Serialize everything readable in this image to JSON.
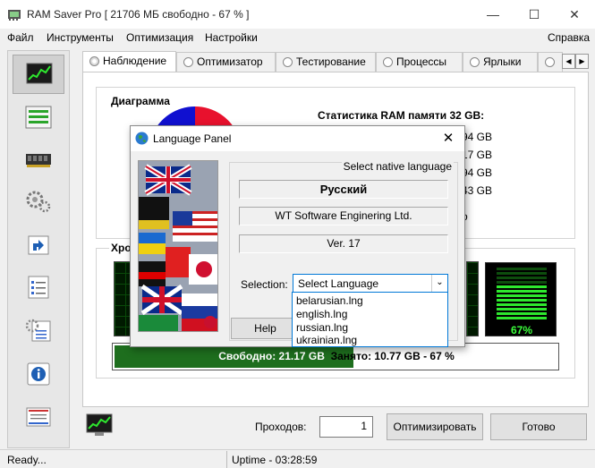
{
  "window": {
    "title": "RAM Saver Pro [ 21706 МБ свободно - 67 % ]",
    "minimize": "—",
    "maximize": "☐",
    "close": "✕"
  },
  "menu": {
    "file": "Файл",
    "tools": "Инструменты",
    "optimization": "Оптимизация",
    "settings": "Настройки",
    "help": "Справка"
  },
  "sidebar": {
    "icons": [
      "monitor-chart-icon",
      "memory-bars-icon",
      "ram-chip-icon",
      "gears-icon",
      "shortcut-arrow-icon",
      "checklist-icon",
      "settings-list-icon",
      "info-icon",
      "report-icon"
    ]
  },
  "tabs": [
    "Наблюдение",
    "Оптимизатор",
    "Тестирование",
    "Процессы",
    "Ярлыки"
  ],
  "tab_scroll": {
    "left": "◀",
    "right": "▶"
  },
  "monitor": {
    "diagram_title": "Диаграмма",
    "stats_title": "Статистика RAM памяти 32 GB:",
    "stat_values": [
      "94 GB",
      "17 GB",
      "94 GB",
      "43 GB"
    ],
    "partial_text": "o",
    "chrono_partial": "Хро",
    "meter_percent": "67%",
    "free_label": "Свободно: 21.17 GB",
    "taken_label": "Занято: 10.77 GB - 67 %",
    "free_fraction": 0.54
  },
  "bottom": {
    "passes_label": "Проходов:",
    "passes_value": "1",
    "optimize_button": "Оптимизировать",
    "done_button": "Готово"
  },
  "status": {
    "left": "Ready...",
    "uptime": "Uptime - 03:28:59"
  },
  "dialog": {
    "title": "Language Panel",
    "close": "✕",
    "group_title": "Select native language",
    "language": "Русский",
    "company": "WT Software Enginering Ltd.",
    "version": "Ver. 17",
    "selection_label": "Selection:",
    "selection_value": "Select Language",
    "combo_arrow": "⌄",
    "help_button": "Help",
    "options": [
      "belarusian.lng",
      "english.lng",
      "russian.lng",
      "ukrainian.lng"
    ]
  },
  "colors": {
    "pie_red": "#e8112d",
    "pie_blue": "#1010d0",
    "graph_green": "#2ee82e",
    "free_bar": "#1e6e1e"
  }
}
